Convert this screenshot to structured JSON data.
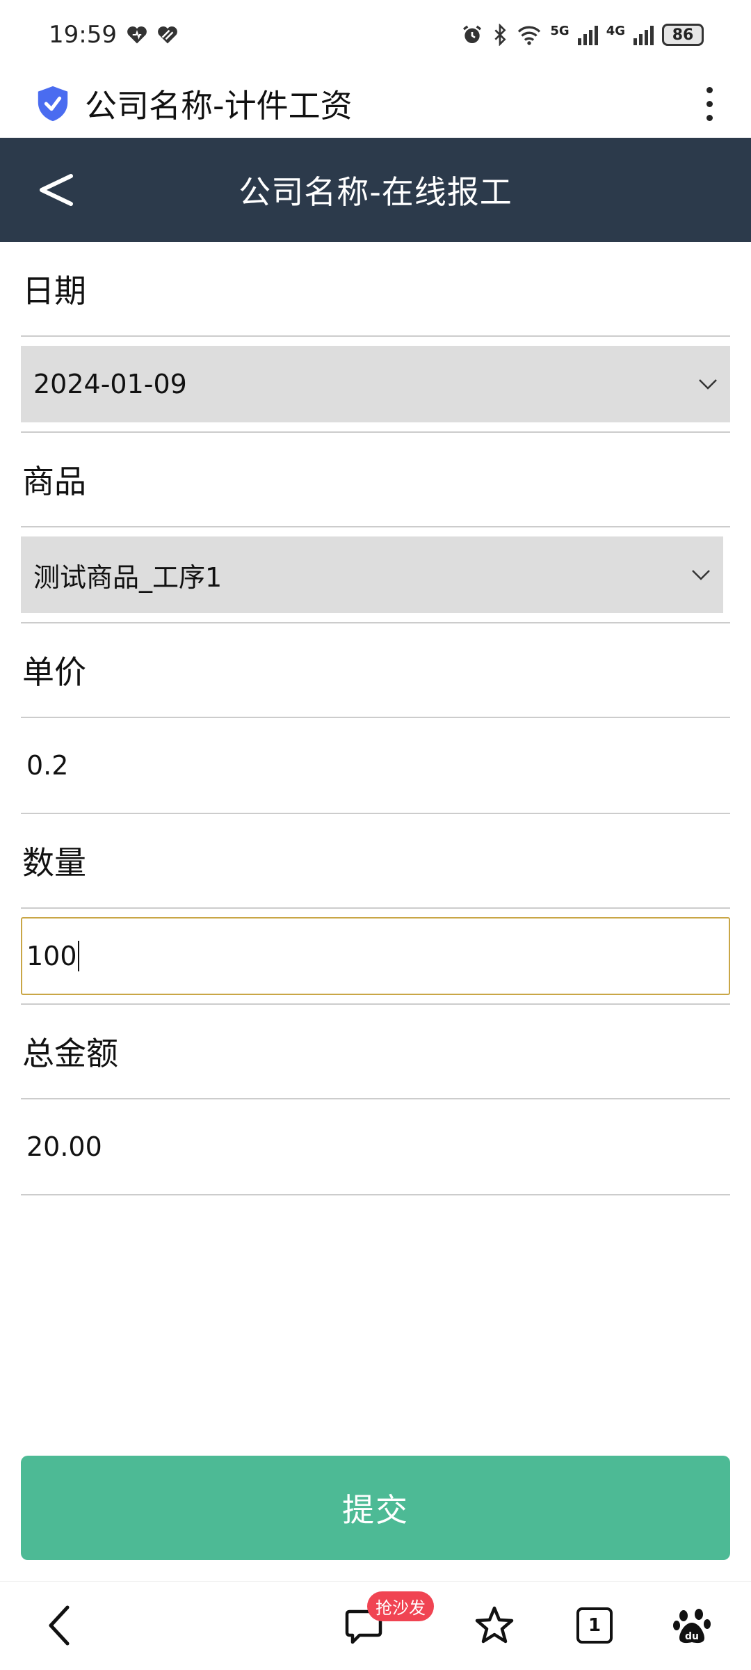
{
  "status_bar": {
    "time": "19:59",
    "network_5g": "5G",
    "network_4g": "4G",
    "battery": "86"
  },
  "browser": {
    "page_title": "公司名称-计件工资"
  },
  "header": {
    "title": "公司名称-在线报工"
  },
  "form": {
    "date_label": "日期",
    "date_value": "2024-01-09",
    "product_label": "商品",
    "product_value": "测试商品_工序1",
    "price_label": "单价",
    "price_value": "0.2",
    "quantity_label": "数量",
    "quantity_value": "100",
    "total_label": "总金额",
    "total_value": "20.00"
  },
  "submit_label": "提交",
  "bottom_nav": {
    "comment_badge": "抢沙发",
    "tab_count": "1"
  },
  "colors": {
    "header_bg": "#2c3a4b",
    "submit_bg": "#4dba95",
    "input_focus_border": "#c9a646",
    "badge_bg": "#f04452",
    "shield_blue": "#4a6cf0"
  }
}
